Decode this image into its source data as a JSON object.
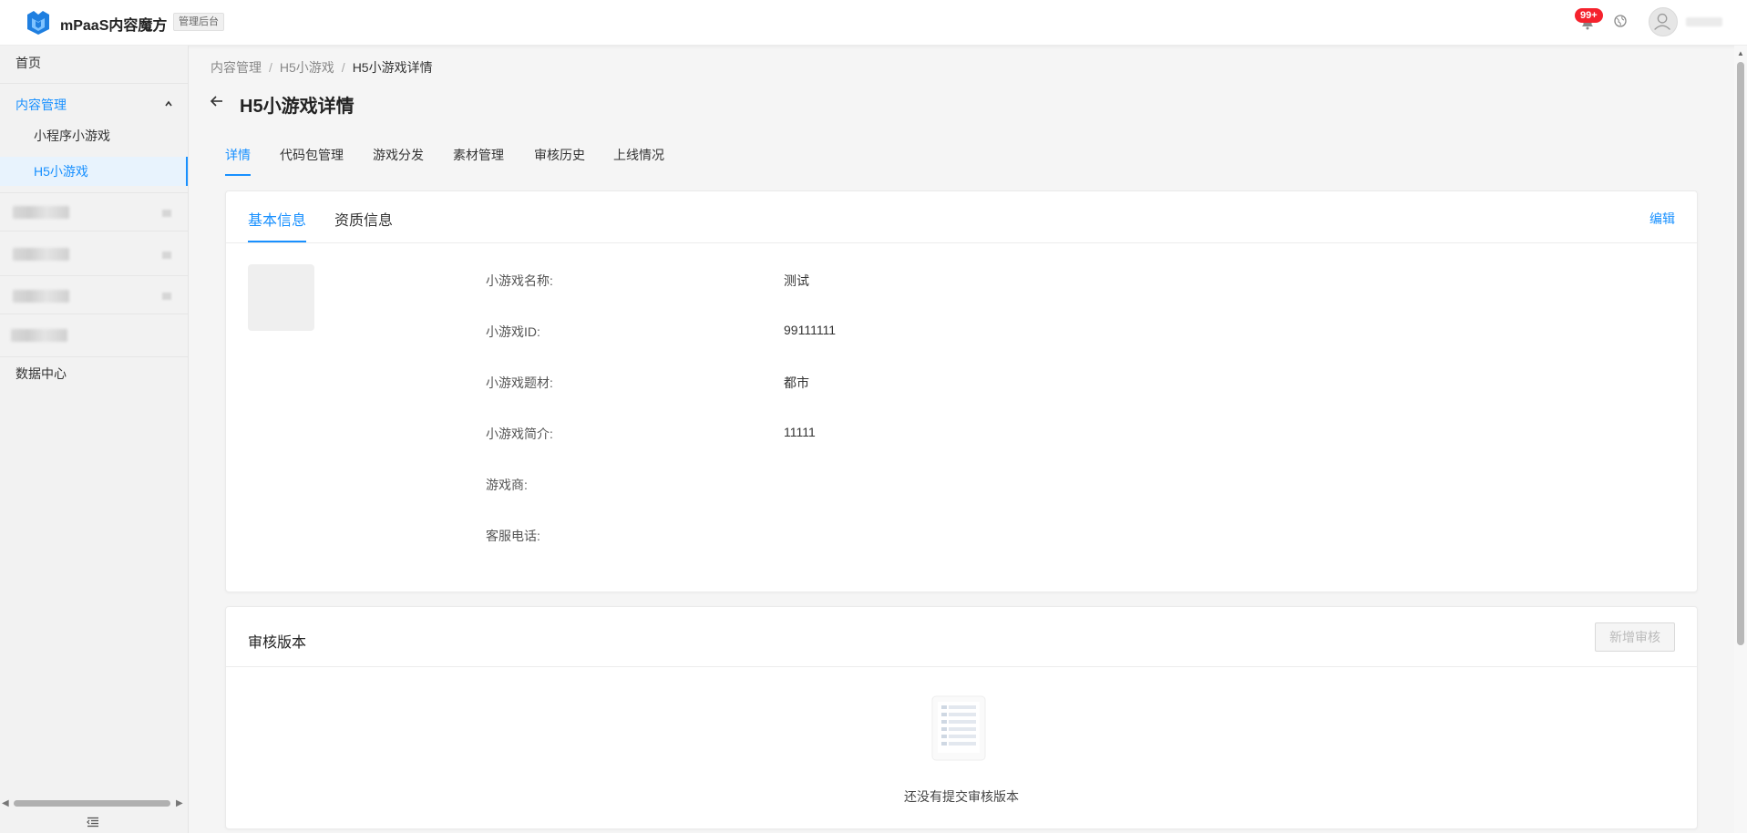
{
  "header": {
    "app_title": "mPaaS内容魔方",
    "admin_badge": "管理后台",
    "notification_count": "99+",
    "colors": {
      "brand": "#1890ff",
      "badge": "#f5222d"
    }
  },
  "sidebar": {
    "home": "首页",
    "content_mgmt": "内容管理",
    "sub_items": [
      "小程序小游戏",
      "H5小游戏"
    ],
    "data_center": "数据中心"
  },
  "breadcrumb": [
    "内容管理",
    "H5小游戏",
    "H5小游戏详情"
  ],
  "page_title": "H5小游戏详情",
  "tabs": [
    "详情",
    "代码包管理",
    "游戏分发",
    "素材管理",
    "审核历史",
    "上线情况"
  ],
  "info_card": {
    "subtabs": [
      "基本信息",
      "资质信息"
    ],
    "edit_label": "编辑",
    "fields": [
      {
        "label": "小游戏名称:",
        "value": "测试"
      },
      {
        "label": "小游戏ID:",
        "value": "99111111"
      },
      {
        "label": "小游戏题材:",
        "value": "都市"
      },
      {
        "label": "小游戏简介:",
        "value": "11111"
      },
      {
        "label": "游戏商:",
        "value": ""
      },
      {
        "label": "客服电话:",
        "value": ""
      }
    ]
  },
  "review_card": {
    "title": "审核版本",
    "add_button": "新增审核",
    "empty_text": "还没有提交审核版本"
  }
}
